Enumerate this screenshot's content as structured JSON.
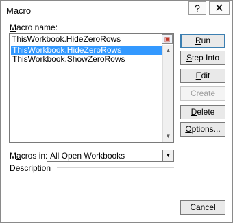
{
  "dialog": {
    "title": "Macro",
    "help_button": "?",
    "close_button": "✕"
  },
  "macro_name": {
    "label_prefix": "M",
    "label_rest": "acro name:",
    "value": "ThisWorkbook.HideZeroRows"
  },
  "macro_list": {
    "items": [
      {
        "label": "ThisWorkbook.HideZeroRows",
        "selected": true
      },
      {
        "label": "ThisWorkbook.ShowZeroRows",
        "selected": false
      }
    ]
  },
  "buttons": {
    "run": {
      "pre": "",
      "u": "R",
      "post": "un"
    },
    "step_into": {
      "pre": "",
      "u": "S",
      "post": "tep Into"
    },
    "edit": {
      "pre": "",
      "u": "E",
      "post": "dit"
    },
    "create": {
      "label": "Create"
    },
    "delete": {
      "pre": "",
      "u": "D",
      "post": "elete"
    },
    "options": {
      "pre": "",
      "u": "O",
      "post": "ptions..."
    },
    "cancel": {
      "label": "Cancel"
    }
  },
  "macros_in": {
    "label_prefix": "M",
    "label_mid": "a",
    "label_rest": "cros in:",
    "selected": "All Open Workbooks"
  },
  "description": {
    "label": "Description"
  }
}
